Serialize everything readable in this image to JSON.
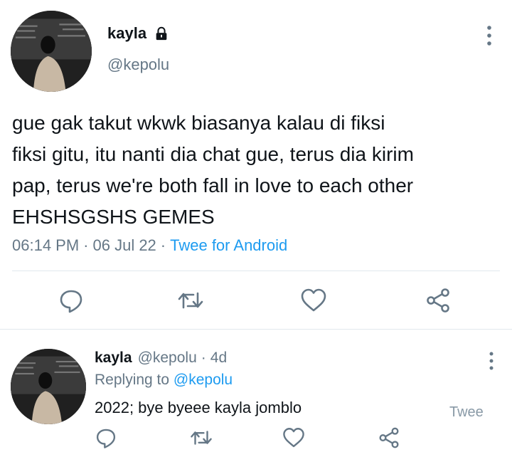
{
  "tweet": {
    "name": "kayla",
    "handle": "@kepolu",
    "text": "gue gak takut wkwk biasanya kalau di fiksi\nfiksi gitu, itu nanti dia chat gue, terus dia kirim\npap, terus we're both fall in love to each other\nEHSHSGSHS GEMES",
    "time": "06:14 PM",
    "date": "06 Jul 22",
    "separator": "·",
    "source": "Twee for Android",
    "icons": {
      "lock": "lock-icon",
      "more": "more-vertical-icon",
      "reply": "reply-icon",
      "retweet": "retweet-icon",
      "like": "heart-icon",
      "share": "share-icon"
    }
  },
  "reply": {
    "name": "kayla",
    "handle": "@kepolu",
    "separator": "·",
    "age": "4d",
    "replying_prefix": "Replying to",
    "replying_to": "@kepolu",
    "text": "2022; bye byeee kayla jomblo",
    "source": "Twee"
  },
  "colors": {
    "text": "#0f1419",
    "secondary": "#657786",
    "accent": "#1d9bf0",
    "divider": "#e1e8ed"
  }
}
